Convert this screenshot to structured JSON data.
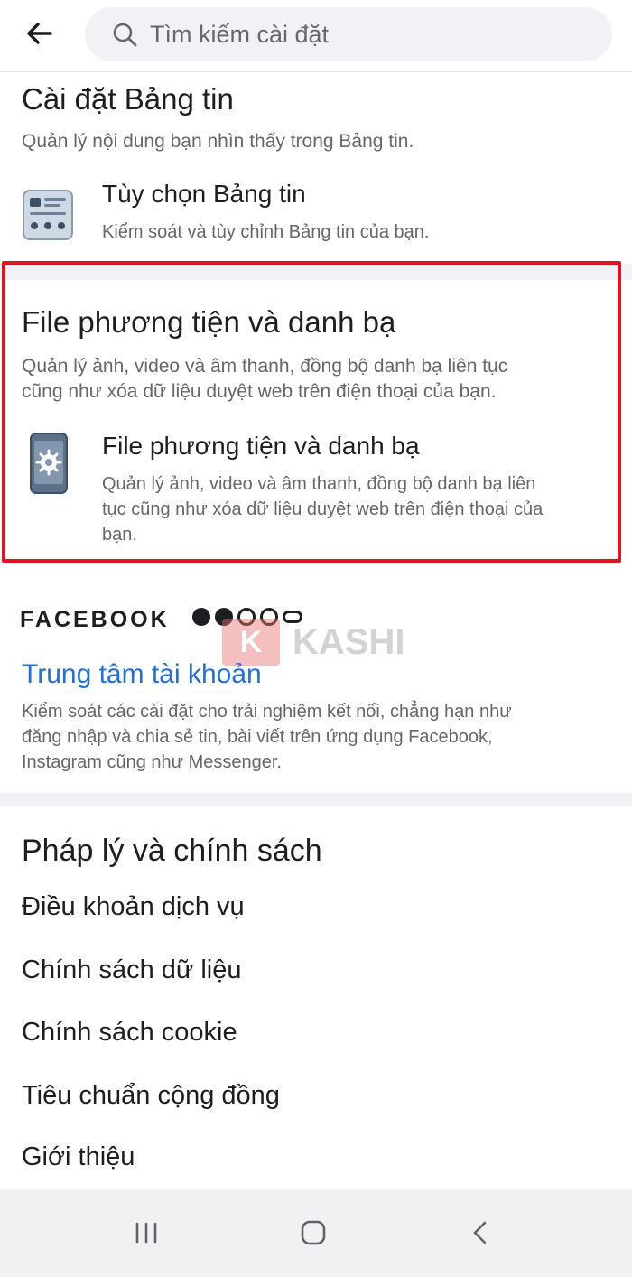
{
  "search": {
    "placeholder": "Tìm kiếm cài đặt"
  },
  "feed_section": {
    "title": "Cài đặt Bảng tin",
    "description": "Quản lý nội dung bạn nhìn thấy trong Bảng tin.",
    "item": {
      "title": "Tùy chọn Bảng tin",
      "description": "Kiểm soát và tùy chỉnh Bảng tin của bạn.",
      "icon": "news-feed-icon"
    }
  },
  "media_section": {
    "title": "File phương tiện và danh bạ",
    "description_lines": [
      "Quản lý ảnh, video và âm thanh, đồng bộ danh bạ liên tục",
      "cũng như xóa dữ liệu duyệt web trên điện thoại của bạn."
    ],
    "item": {
      "title": "File phương tiện và danh bạ",
      "description_lines": [
        "Quản lý ảnh, video và âm thanh, đồng bộ danh bạ liên",
        "tục cũng như xóa dữ liệu duyệt web trên điện thoại của",
        "bạn."
      ],
      "icon": "phone-settings-icon"
    },
    "highlight_color": "#e0141e"
  },
  "accounts_section": {
    "brand": "FACEBOOK",
    "brand_icons": [
      "facebook-icon",
      "messenger-icon",
      "instagram-icon",
      "whatsapp-icon",
      "oculus-icon"
    ],
    "link": "Trung tâm tài khoản",
    "description_lines": [
      "Kiểm soát các cài đặt cho trải nghiệm kết nối, chẳng hạn như",
      "đăng nhập và chia sẻ tin, bài viết trên ứng dụng Facebook,",
      "Instagram cũng như Messenger."
    ],
    "link_color": "#216fdb"
  },
  "watermark": {
    "badge": "K",
    "text": "KASHI"
  },
  "legal_section": {
    "title": "Pháp lý và chính sách",
    "items": [
      "Điều khoản dịch vụ",
      "Chính sách dữ liệu",
      "Chính sách cookie",
      "Tiêu chuẩn cộng đồng",
      "Giới thiệu"
    ]
  },
  "system_nav": {
    "icons": [
      "recent-apps-icon",
      "home-icon",
      "back-icon"
    ]
  }
}
